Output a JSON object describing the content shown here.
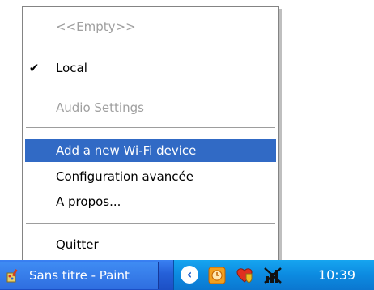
{
  "menu": {
    "items": [
      {
        "label": "<<Empty>>",
        "enabled": false,
        "checked": false,
        "highlighted": false
      },
      {
        "label": "Local",
        "enabled": true,
        "checked": true,
        "highlighted": false
      },
      {
        "label": "Audio Settings",
        "enabled": false,
        "checked": false,
        "highlighted": false
      },
      {
        "label": "Add a new Wi-Fi device",
        "enabled": true,
        "checked": false,
        "highlighted": true
      },
      {
        "label": "Configuration avancée",
        "enabled": true,
        "checked": false,
        "highlighted": false
      },
      {
        "label": "A propos...",
        "enabled": true,
        "checked": false,
        "highlighted": false
      },
      {
        "label": "Quitter",
        "enabled": true,
        "checked": false,
        "highlighted": false
      }
    ],
    "check_glyph": "✔"
  },
  "taskbar": {
    "task_label": "Sans titre - Paint",
    "tray_icons": [
      "show-hidden-icons-arrow",
      "orange-clock-icon",
      "heart-shield-icon",
      "network-disconnected-icon"
    ],
    "clock": "10:39"
  },
  "colors": {
    "highlight": "#316ac5",
    "disabled_text": "#a0a0a0",
    "taskbar": "#2560d8",
    "tray": "#0c8ae0"
  }
}
